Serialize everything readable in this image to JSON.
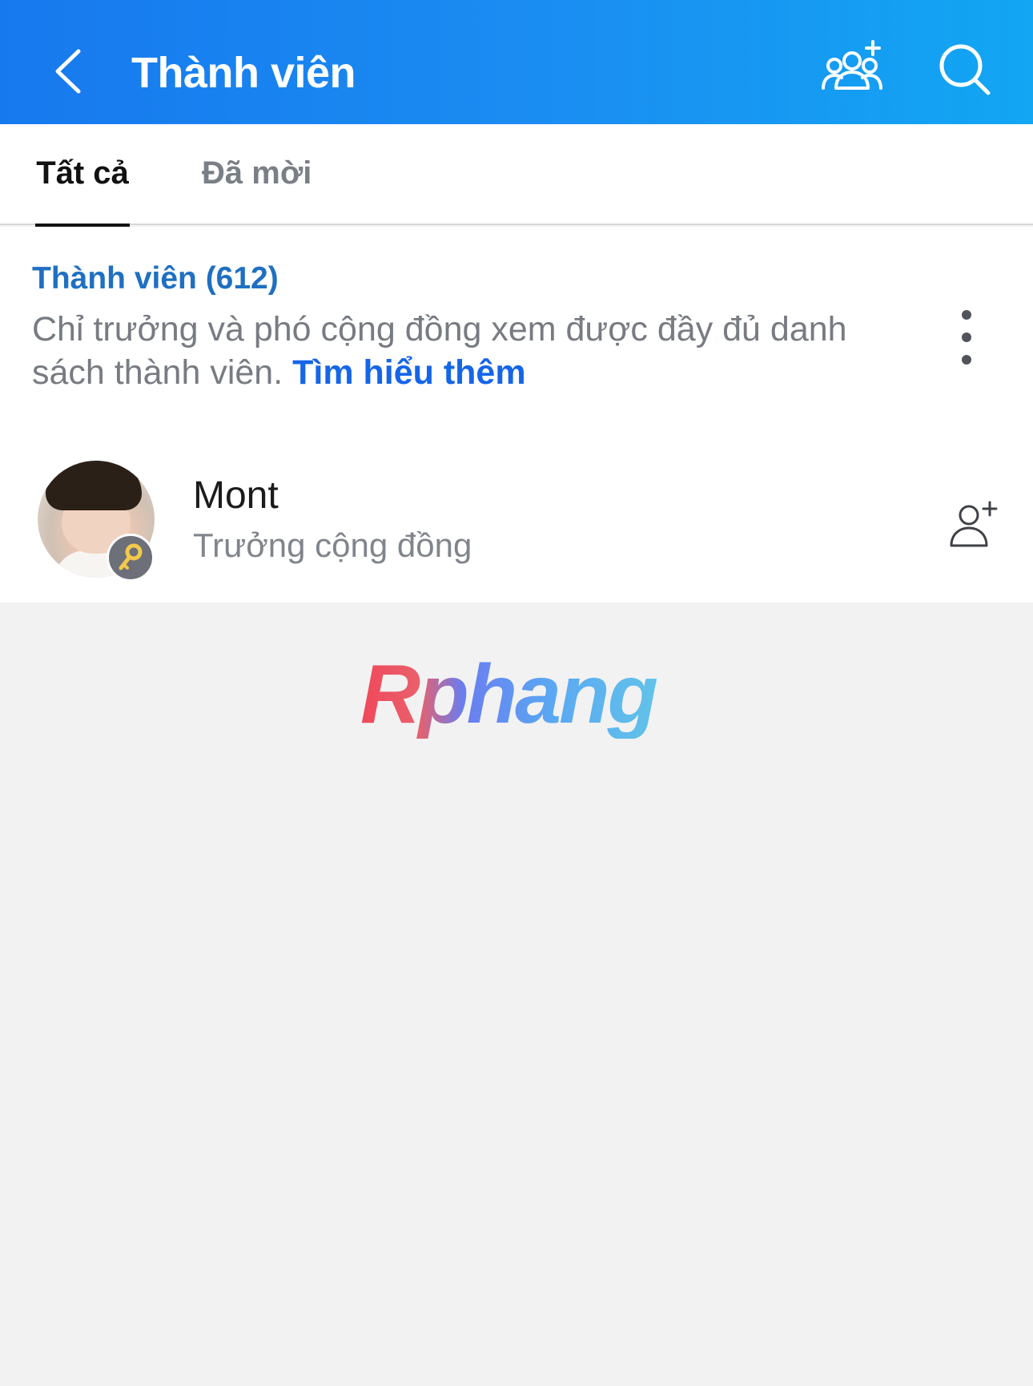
{
  "header": {
    "title": "Thành viên",
    "back_icon": "chevron-left-icon",
    "add_member_icon": "group-add-icon",
    "search_icon": "search-icon",
    "color": "#1a8ef2"
  },
  "tabs": [
    {
      "label": "Tất cả",
      "active": true
    },
    {
      "label": "Đã mời",
      "active": false
    }
  ],
  "members_section": {
    "title": "Thành viên (612)",
    "description": "Chỉ trưởng và phó cộng đồng xem được đầy đủ danh sách thành viên. ",
    "learn_more": "Tìm hiểu thêm",
    "more_icon": "more-vertical-icon"
  },
  "members": [
    {
      "name": "Mont",
      "role": "Trưởng cộng đồng",
      "badge_icon": "key-icon",
      "action_icon": "add-friend-icon"
    }
  ],
  "watermark": "Rphang",
  "colors": {
    "accent": "#1f6fc2",
    "link": "#1565e8",
    "background": "#f2f2f2"
  }
}
